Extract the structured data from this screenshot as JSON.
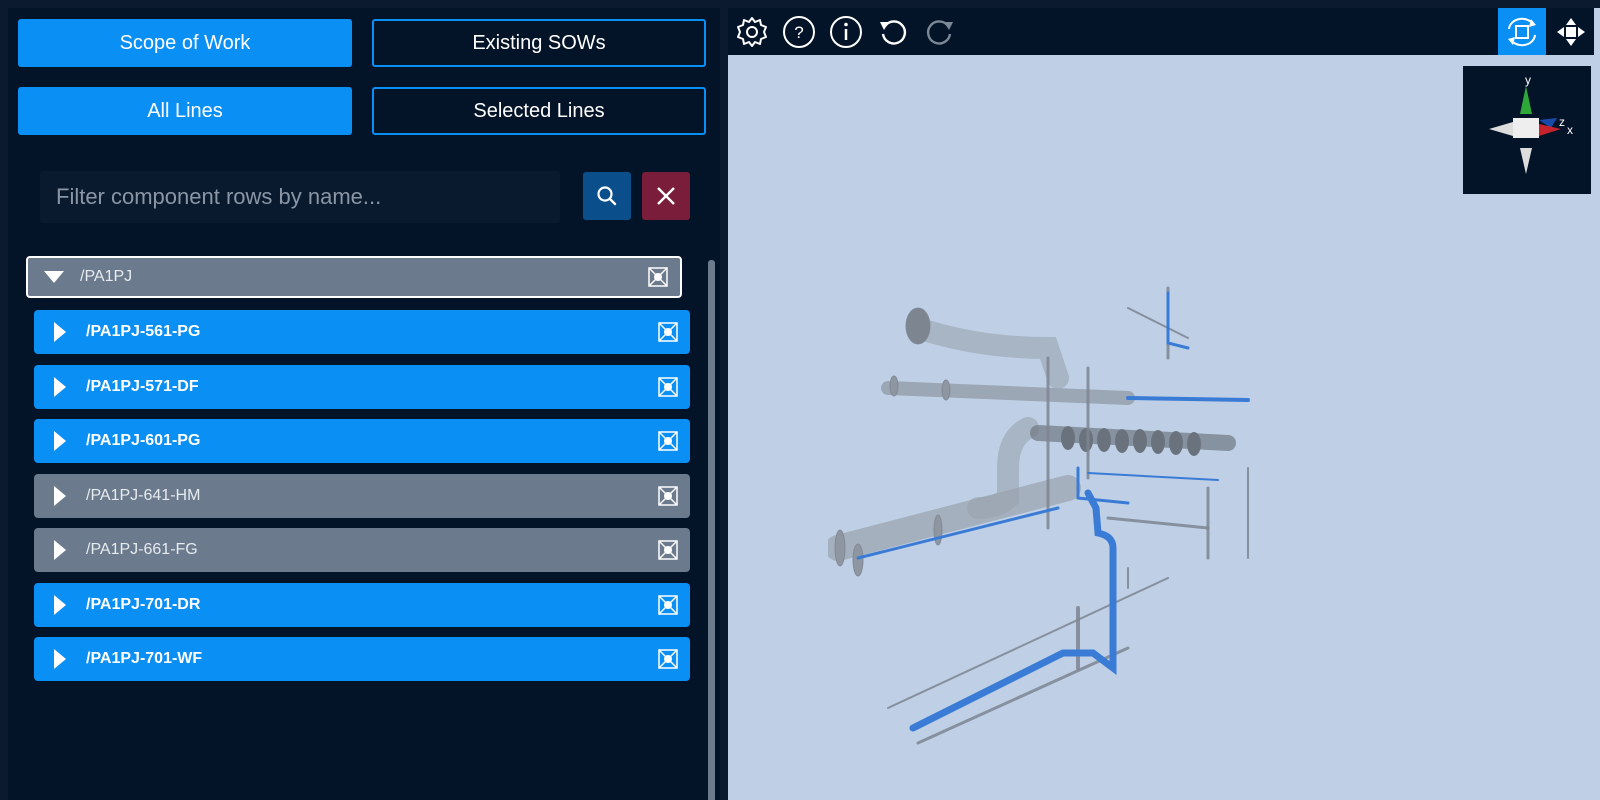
{
  "left_panel": {
    "tabs": {
      "scope_of_work": "Scope of Work",
      "existing_sows": "Existing SOWs",
      "all_lines": "All Lines",
      "selected_lines": "Selected Lines"
    },
    "filter": {
      "placeholder": "Filter component rows by name...",
      "value": ""
    },
    "tree": {
      "root": {
        "label": "/PA1PJ",
        "expanded": true
      },
      "items": [
        {
          "label": "/PA1PJ-561-PG",
          "state": "on"
        },
        {
          "label": "/PA1PJ-571-DF",
          "state": "on"
        },
        {
          "label": "/PA1PJ-601-PG",
          "state": "on"
        },
        {
          "label": "/PA1PJ-641-HM",
          "state": "off"
        },
        {
          "label": "/PA1PJ-661-FG",
          "state": "off"
        },
        {
          "label": "/PA1PJ-701-DR",
          "state": "on"
        },
        {
          "label": "/PA1PJ-701-WF",
          "state": "on"
        }
      ]
    }
  },
  "viewport": {
    "toolbar": {
      "icons": [
        "gear-icon",
        "help-icon",
        "info-icon",
        "undo-icon",
        "redo-icon",
        "orbit-icon",
        "pan-icon"
      ],
      "active": "orbit-icon"
    },
    "gizmo": {
      "labels": {
        "y": "y",
        "z": "z",
        "x": "x"
      }
    }
  },
  "colors": {
    "accent": "#0a8ff5",
    "panel_bg": "#041428",
    "inactive_row": "#6b7a8c",
    "viewport_bg": "#bfd0e6",
    "clear_button": "#7a1d3a",
    "search_button": "#0a4e8c"
  }
}
